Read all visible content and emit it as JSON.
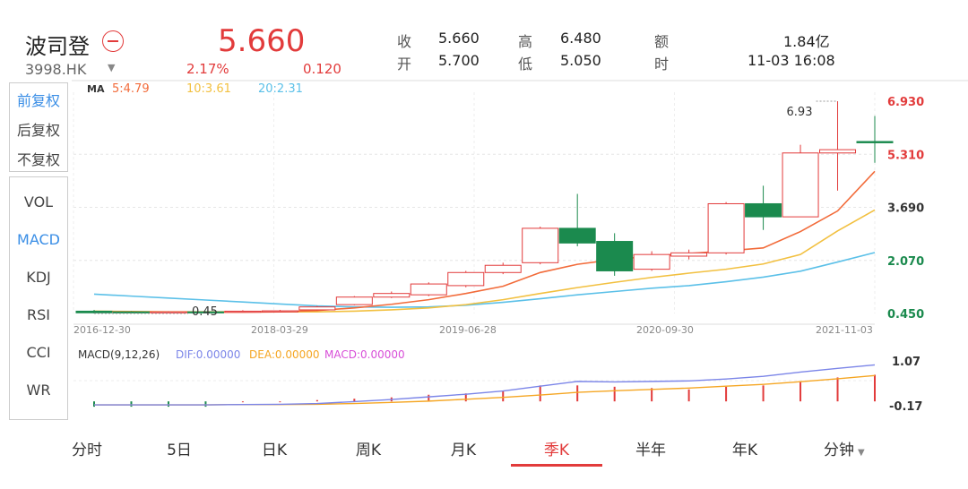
{
  "header": {
    "name": "波司登",
    "code": "3998.HK",
    "price": "5.660",
    "change_pct": "2.17%",
    "change_abs": "0.120",
    "quote": [
      {
        "label": "收",
        "value": "5.660"
      },
      {
        "label": "开",
        "value": "5.700"
      },
      {
        "label": "高",
        "value": "6.480"
      },
      {
        "label": "低",
        "value": "5.050"
      },
      {
        "label": "额",
        "value": "1.84亿"
      },
      {
        "label": "时",
        "value": "11-03 16:08"
      }
    ]
  },
  "adjust": [
    "前复权",
    "后复权",
    "不复权"
  ],
  "indicators": [
    "VOL",
    "MACD",
    "KDJ",
    "RSI",
    "CCI",
    "WR"
  ],
  "tabs": [
    "分时",
    "5日",
    "日K",
    "周K",
    "月K",
    "季K",
    "半年",
    "年K",
    "分钟"
  ],
  "colors": {
    "up": "#e23b3b",
    "down": "#1b8a4e",
    "ma5": "#f26b3a",
    "ma10": "#f2c040",
    "ma20": "#5bc0e8",
    "dea": "#f5a623",
    "dif": "#7b85e8",
    "macd": "#d84fd8"
  },
  "chart_data": {
    "type": "candlestick",
    "ma_legend": {
      "label": "MA",
      "ma5": "5:4.79",
      "ma10": "10:3.61",
      "ma20": "20:2.31"
    },
    "y_ticks": [
      "6.930",
      "5.310",
      "3.690",
      "2.070",
      "0.450"
    ],
    "ylim": [
      0.45,
      6.93
    ],
    "x_ticks": [
      "2016-12-30",
      "2018-03-29",
      "2019-06-28",
      "2020-09-30",
      "2021-11-03"
    ],
    "annotations": {
      "max": "6.93",
      "min": "0.45"
    },
    "candles": [
      {
        "o": 0.52,
        "c": 0.47,
        "h": 0.56,
        "l": 0.45
      },
      {
        "o": 0.5,
        "c": 0.49,
        "h": 0.52,
        "l": 0.47
      },
      {
        "o": 0.49,
        "c": 0.5,
        "h": 0.52,
        "l": 0.47
      },
      {
        "o": 0.5,
        "c": 0.49,
        "h": 0.52,
        "l": 0.47
      },
      {
        "o": 0.5,
        "c": 0.52,
        "h": 0.55,
        "l": 0.48
      },
      {
        "o": 0.52,
        "c": 0.53,
        "h": 0.56,
        "l": 0.5
      },
      {
        "o": 0.56,
        "c": 0.65,
        "h": 0.68,
        "l": 0.54
      },
      {
        "o": 0.72,
        "c": 0.95,
        "h": 0.98,
        "l": 0.7
      },
      {
        "o": 0.95,
        "c": 1.06,
        "h": 1.12,
        "l": 0.92
      },
      {
        "o": 1.02,
        "c": 1.35,
        "h": 1.4,
        "l": 0.98
      },
      {
        "o": 1.3,
        "c": 1.7,
        "h": 1.75,
        "l": 1.25
      },
      {
        "o": 1.7,
        "c": 1.92,
        "h": 2.0,
        "l": 1.65
      },
      {
        "o": 2.0,
        "c": 3.05,
        "h": 3.1,
        "l": 1.95
      },
      {
        "o": 3.05,
        "c": 2.6,
        "h": 4.1,
        "l": 2.5
      },
      {
        "o": 2.65,
        "c": 1.75,
        "h": 2.9,
        "l": 1.6
      },
      {
        "o": 1.8,
        "c": 2.25,
        "h": 2.35,
        "l": 1.75
      },
      {
        "o": 2.2,
        "c": 2.3,
        "h": 2.4,
        "l": 2.1
      },
      {
        "o": 2.3,
        "c": 3.8,
        "h": 3.85,
        "l": 2.25
      },
      {
        "o": 3.8,
        "c": 3.4,
        "h": 4.35,
        "l": 3.0
      },
      {
        "o": 3.4,
        "c": 5.35,
        "h": 5.6,
        "l": 3.4
      },
      {
        "o": 5.35,
        "c": 5.45,
        "h": 6.93,
        "l": 4.2
      },
      {
        "o": 5.7,
        "c": 5.66,
        "h": 6.48,
        "l": 5.05
      }
    ],
    "ma5": [
      0.5,
      0.5,
      0.49,
      0.49,
      0.49,
      0.5,
      0.54,
      0.62,
      0.73,
      0.87,
      1.06,
      1.28,
      1.7,
      1.95,
      2.1,
      2.2,
      2.28,
      2.36,
      2.45,
      2.95,
      3.58,
      4.79
    ],
    "ma10": [
      0.52,
      0.51,
      0.5,
      0.5,
      0.5,
      0.5,
      0.5,
      0.52,
      0.56,
      0.62,
      0.72,
      0.87,
      1.06,
      1.24,
      1.4,
      1.55,
      1.68,
      1.8,
      1.96,
      2.25,
      2.97,
      3.61
    ],
    "ma20": [
      1.04,
      0.98,
      0.92,
      0.86,
      0.8,
      0.74,
      0.68,
      0.65,
      0.64,
      0.65,
      0.7,
      0.79,
      0.9,
      1.02,
      1.12,
      1.22,
      1.3,
      1.42,
      1.56,
      1.74,
      2.02,
      2.31
    ],
    "macd": {
      "title": "MACD(9,12,26)",
      "dif_label": "DIF:0.00000",
      "dea_label": "DEA:0.00000",
      "macd_label": "MACD:0.00000",
      "y_ticks": [
        "1.07",
        "-0.17"
      ],
      "ylim": [
        -0.4,
        1.35
      ],
      "dif": [
        -0.3,
        -0.3,
        -0.3,
        -0.3,
        -0.29,
        -0.28,
        -0.25,
        -0.18,
        -0.1,
        0.0,
        0.1,
        0.22,
        0.4,
        0.58,
        0.56,
        0.58,
        0.6,
        0.67,
        0.77,
        0.93,
        1.07,
        1.2
      ],
      "dea": [
        -0.3,
        -0.3,
        -0.3,
        -0.3,
        -0.29,
        -0.29,
        -0.28,
        -0.25,
        -0.21,
        -0.16,
        -0.09,
        -0.02,
        0.07,
        0.17,
        0.23,
        0.28,
        0.33,
        0.4,
        0.47,
        0.57,
        0.68,
        0.8
      ],
      "bars": [
        -0.2,
        -0.2,
        -0.2,
        -0.2,
        0.0,
        0.0,
        0.05,
        0.1,
        0.15,
        0.25,
        0.3,
        0.4,
        0.6,
        0.6,
        0.55,
        0.5,
        0.45,
        0.55,
        0.6,
        0.75,
        0.9,
        1.0
      ]
    }
  }
}
